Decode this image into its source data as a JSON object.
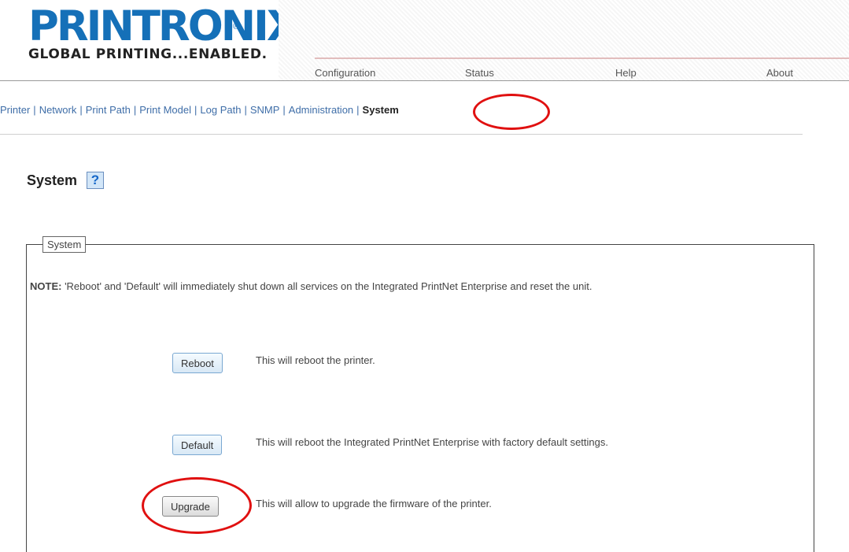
{
  "header": {
    "logo_text": "PRINTRONIX",
    "logo_reg": "®",
    "tagline": "GLOBAL PRINTING...ENABLED."
  },
  "top_nav": {
    "items": [
      "Configuration",
      "Status",
      "Help",
      "About"
    ]
  },
  "sub_nav": {
    "items": [
      "Printer",
      "Network",
      "Print Path",
      "Print Model",
      "Log Path",
      "SNMP",
      "Administration"
    ],
    "current": "System",
    "separator": "|"
  },
  "page": {
    "title": "System",
    "help_icon_glyph": "?"
  },
  "system_panel": {
    "legend": "System",
    "note_label": "NOTE:",
    "note_text": " 'Reboot' and 'Default' will immediately shut down all services on the Integrated PrintNet Enterprise and reset the unit.",
    "actions": [
      {
        "label": "Reboot",
        "description": "This will reboot the printer."
      },
      {
        "label": "Default",
        "description": "This will reboot the Integrated PrintNet Enterprise with factory default settings."
      },
      {
        "label": "Upgrade",
        "description": "This will allow to upgrade the firmware of the printer."
      }
    ]
  },
  "colors": {
    "brand_blue": "#1570b8",
    "link_blue": "#3f6ea8",
    "annotation_red": "#e01010"
  },
  "icons": {
    "help": "help-icon"
  }
}
